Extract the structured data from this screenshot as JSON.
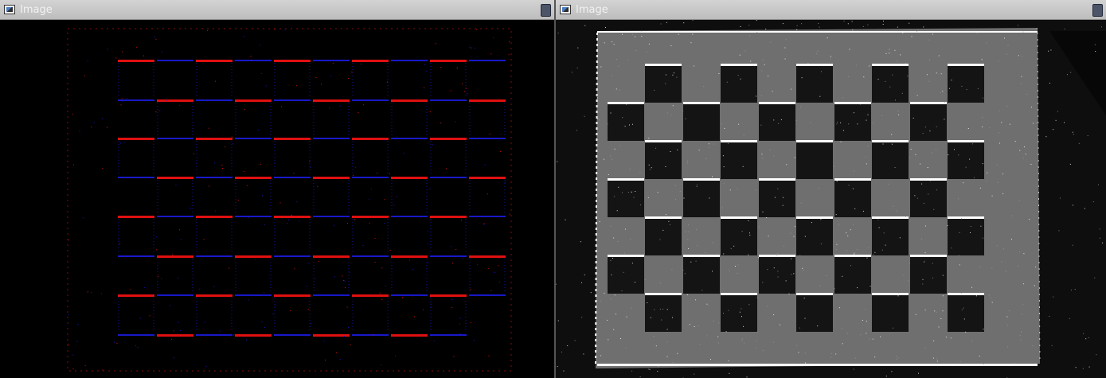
{
  "windows": [
    {
      "title": "Image",
      "icon": "image-window-icon",
      "view": "event-polarity-map"
    },
    {
      "title": "Image",
      "icon": "image-window-icon",
      "view": "grayscale-checkerboard"
    }
  ],
  "colors": {
    "titlebar": "#c6c6c6",
    "title_text": "#f2f2f2",
    "positive_events": "#e01010",
    "negative_events": "#1818c8",
    "background": "#000000",
    "light_square": "#6f6f6f",
    "dark_square": "#141414",
    "edge_highlight": "#ffffff"
  }
}
